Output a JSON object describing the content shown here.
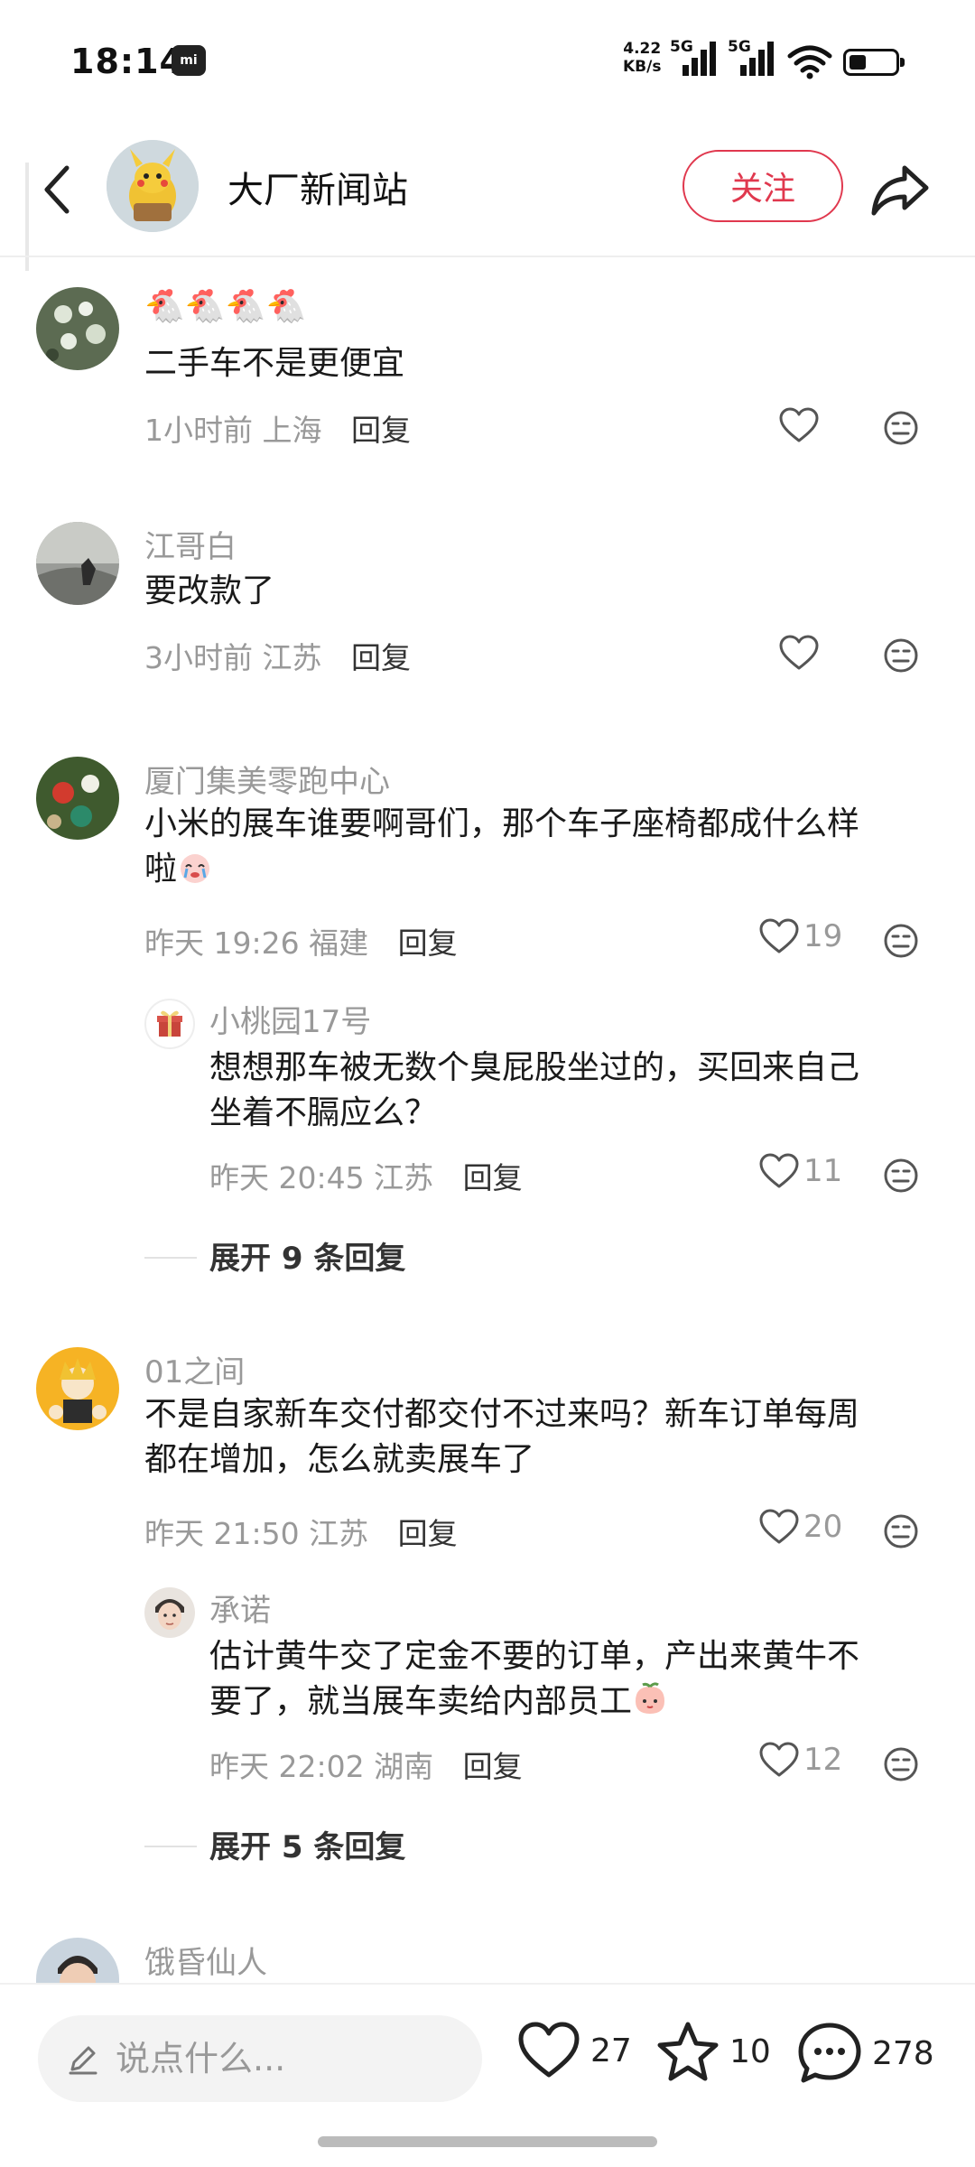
{
  "status_bar": {
    "time": "18:14",
    "mi_badge": "mi",
    "net_speed_value": "4.22",
    "net_speed_unit": "KB/s",
    "sim1_label": "5G",
    "sim2_label": "5G"
  },
  "header": {
    "title": "大厂新闻站",
    "follow_label": "关注"
  },
  "comments": [
    {
      "username": "🐔🐔🐔🐔",
      "text": "二手车不是更便宜",
      "time": "1小时前",
      "location": "上海",
      "reply_label": "回复",
      "likes": ""
    },
    {
      "username": "江哥白",
      "text": "要改款了",
      "time": "3小时前",
      "location": "江苏",
      "reply_label": "回复",
      "likes": ""
    },
    {
      "username": "厦门集美零跑中心",
      "text_line1": "小米的展车谁要啊哥们，那个车子座椅都成什么样",
      "text_line2": "啦",
      "time": "昨天 19:26",
      "location": "福建",
      "reply_label": "回复",
      "likes": "19",
      "sub_reply": {
        "username": "小桃园17号",
        "text_line1": "想想那车被无数个臭屁股坐过的，买回来自己",
        "text_line2": "坐着不膈应么？",
        "time": "昨天 20:45",
        "location": "江苏",
        "reply_label": "回复",
        "likes": "11"
      },
      "expand_label": "展开 9 条回复"
    },
    {
      "username": "01之间",
      "text_line1": "不是自家新车交付都交付不过来吗？新车订单每周",
      "text_line2": "都在增加，怎么就卖展车了",
      "time": "昨天 21:50",
      "location": "江苏",
      "reply_label": "回复",
      "likes": "20",
      "sub_reply": {
        "username": "承诺",
        "text_line1": "估计黄牛交了定金不要的订单，产出来黄牛不",
        "text_line2": "要了，就当展车卖给内部员工",
        "time": "昨天 22:02",
        "location": "湖南",
        "reply_label": "回复",
        "likes": "12"
      },
      "expand_label": "展开 5 条回复"
    },
    {
      "username": "饿昏仙人"
    }
  ],
  "bottom_bar": {
    "input_placeholder": "说点什么...",
    "likes": "27",
    "favorites": "10",
    "comments": "278"
  },
  "colors": {
    "accent": "#e0384e",
    "muted_text": "#999999",
    "body_text": "#1a1a1a"
  }
}
